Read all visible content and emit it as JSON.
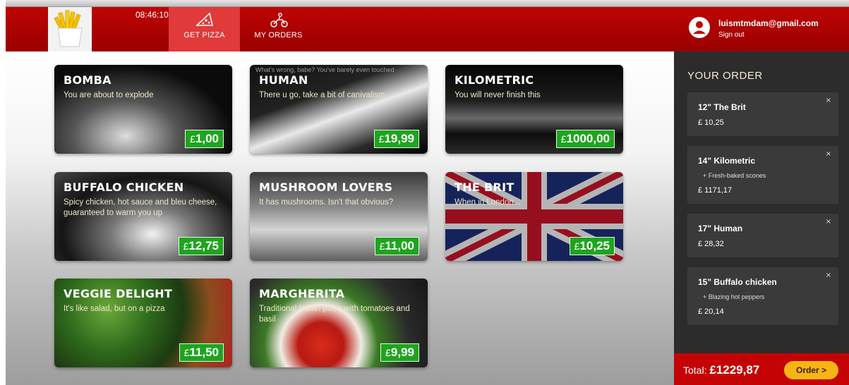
{
  "header": {
    "clock": "08:46:10",
    "tabs": [
      {
        "label": "GET PIZZA",
        "icon": "pizza-slice-icon",
        "active": true
      },
      {
        "label": "MY ORDERS",
        "icon": "delivery-scooter-icon",
        "active": false
      }
    ],
    "user": {
      "email": "luismtmdam@gmail.com",
      "signout": "Sign out"
    }
  },
  "pizzas": [
    {
      "name": "BOMBA",
      "desc": "You are about to explode",
      "currency": "£",
      "price": "1,00"
    },
    {
      "name": "HUMAN",
      "desc": "There u go, take a bit of canivalism",
      "overlay": "What's wrong, babe? You've barely even touched",
      "currency": "£",
      "price": "19,99"
    },
    {
      "name": "KILOMETRIC",
      "desc": "You will never finish this",
      "currency": "£",
      "price": "1000,00"
    },
    {
      "name": "BUFFALO CHICKEN",
      "desc": "Spicy chicken, hot sauce and bleu cheese, guaranteed to warm you up",
      "currency": "£",
      "price": "12,75"
    },
    {
      "name": "MUSHROOM LOVERS",
      "desc": "It has mushrooms. Isn't that obvious?",
      "currency": "£",
      "price": "11,00"
    },
    {
      "name": "THE BRIT",
      "desc": "When in London...",
      "currency": "£",
      "price": "10,25"
    },
    {
      "name": "VEGGIE DELIGHT",
      "desc": "It's like salad, but on a pizza",
      "currency": "£",
      "price": "11,50"
    },
    {
      "name": "MARGHERITA",
      "desc": "Traditional Italian pizza with tomatoes and basil",
      "currency": "£",
      "price": "9,99"
    }
  ],
  "order": {
    "title": "YOUR ORDER",
    "items": [
      {
        "name": "12\" The Brit",
        "extra": "",
        "price": "£ 10,25"
      },
      {
        "name": "14\" Kilometric",
        "extra": "+ Fresh-baked scones",
        "price": "£ 1171,17"
      },
      {
        "name": "17\" Human",
        "extra": "",
        "price": "£ 28,32"
      },
      {
        "name": "15\" Buffalo chicken",
        "extra": "+ Blazing hot peppers",
        "price": "£ 20,14"
      }
    ],
    "close_glyph": "×",
    "total_label": "Total:",
    "total_value": "£1229,87",
    "order_button": "Order >"
  },
  "colors": {
    "header_red": "#c40404",
    "price_green": "#1fa41f",
    "order_button": "#f7b515",
    "sidebar": "#2c2c2c"
  }
}
